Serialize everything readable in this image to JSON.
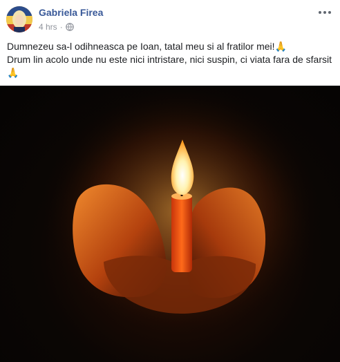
{
  "post": {
    "author": "Gabriela Firea",
    "time": "4 hrs",
    "separator": "·",
    "privacy_icon": "globe-icon",
    "more_icon": "more-options-icon",
    "text_line1": "Dumnezeu sa-l odihneasca pe Ioan, tatal meu si al fratilor mei!🙏",
    "text_line2": "Drum lin acolo unde nu este nici intristare, nici suspin, ci viata fara de sfarsit",
    "text_line3": "🙏",
    "image_subject": "candle-in-hands-photo"
  },
  "colors": {
    "author_link": "#385898",
    "meta_gray": "#90949c",
    "text": "#1c1e21",
    "photo_dark": "#050403",
    "flame": "#fff3b0"
  }
}
